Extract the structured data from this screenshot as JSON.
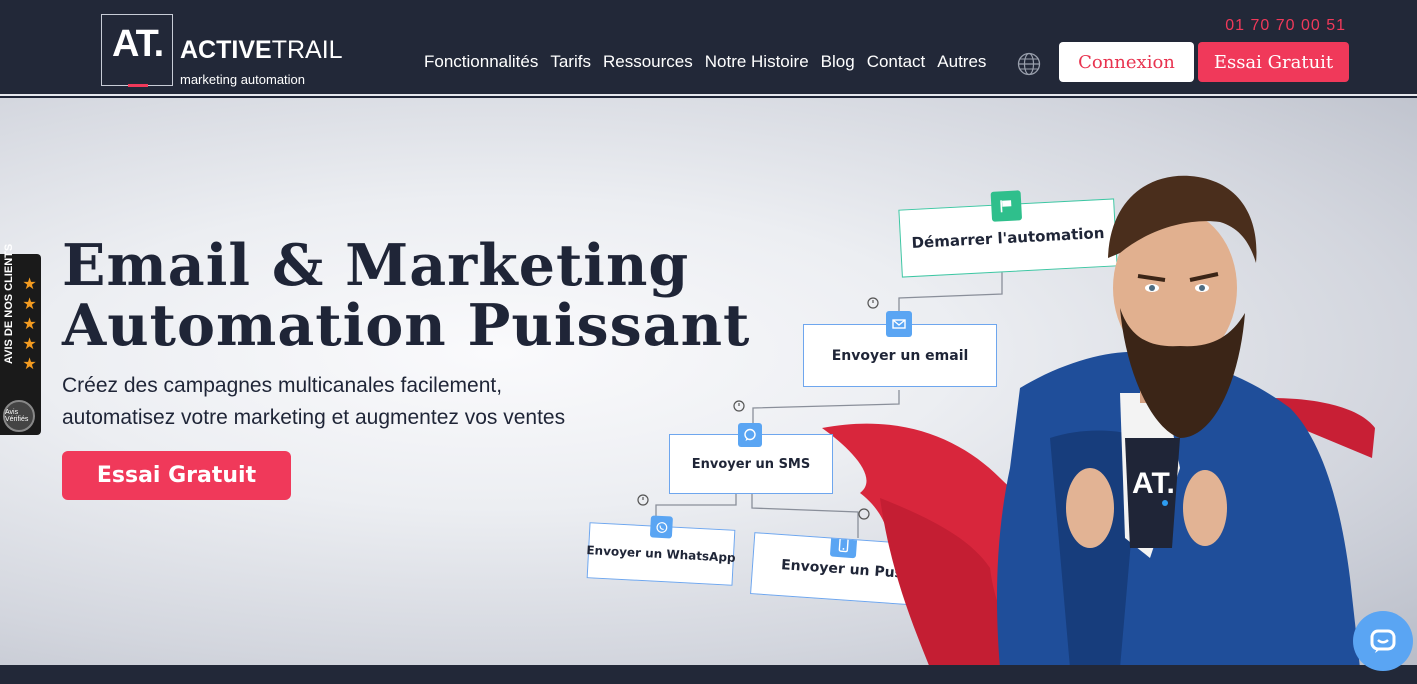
{
  "header": {
    "logo_mark": "AT.",
    "brand_bold": "ACTIVE",
    "brand_light": "TRAIL",
    "tagline": "marketing automation",
    "phone": "01 70 70 00 51",
    "nav": [
      "Fonctionnalités",
      "Tarifs",
      "Ressources",
      "Notre Histoire",
      "Blog",
      "Contact",
      "Autres"
    ],
    "login_label": "Connexion",
    "trial_label": "Essai Gratuit"
  },
  "hero": {
    "title_line1": "Email & Marketing",
    "title_line2": "Automation Puissant",
    "subtitle_line1": "Créez des campagnes multicanales facilement,",
    "subtitle_line2": "automatisez votre marketing et augmentez vos ventes",
    "cta_label": "Essai Gratuit"
  },
  "reviews": {
    "label": "AVIS DE NOS CLIENTS",
    "stars": "★★★★★",
    "badge": "Avis Vérifiés"
  },
  "flow": {
    "start": "Démarrer l'automation",
    "email": "Envoyer un email",
    "sms": "Envoyer un SMS",
    "whatsapp": "Envoyer un WhatsApp",
    "push": "Envoyer un Push"
  },
  "figure": {
    "shirt_logo": "AT."
  },
  "colors": {
    "header_bg": "#222838",
    "accent": "#f0395a",
    "icon_blue": "#5aa5f3",
    "icon_green": "#2fbf8c"
  },
  "icons": {
    "globe": "globe-icon",
    "chat": "chat-icon",
    "flag": "flag-icon",
    "mail": "mail-icon",
    "sms": "speech-bubble-icon",
    "whatsapp": "whatsapp-icon",
    "push": "phone-icon",
    "timer": "timer-icon"
  }
}
